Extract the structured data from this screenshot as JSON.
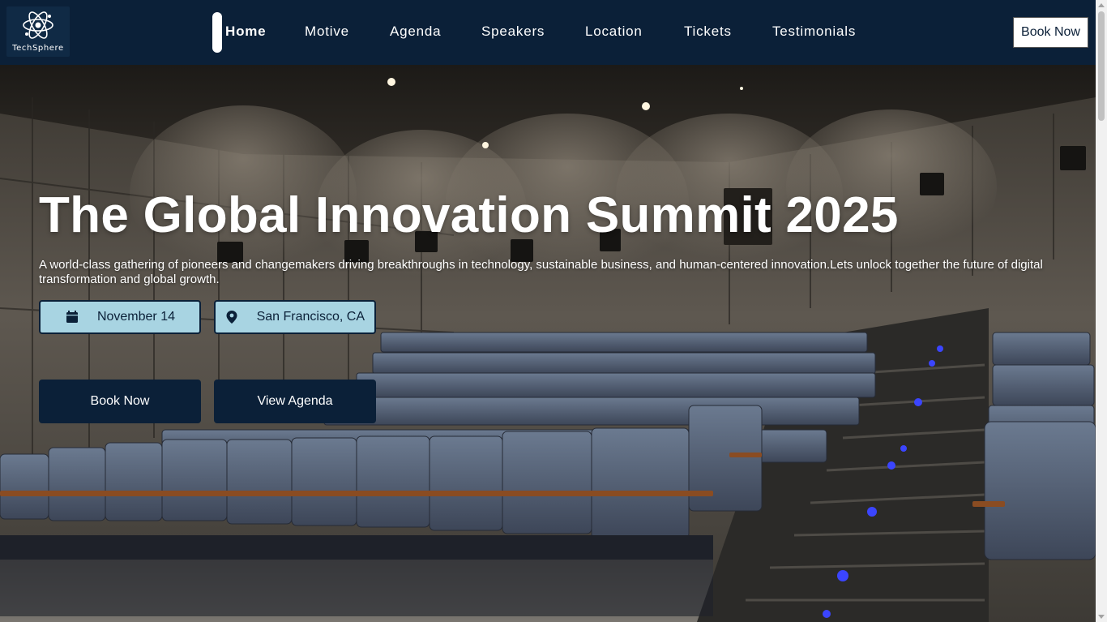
{
  "brand": {
    "name": "TechSphere"
  },
  "nav": {
    "items": [
      {
        "label": "Home"
      },
      {
        "label": "Motive"
      },
      {
        "label": "Agenda"
      },
      {
        "label": "Speakers"
      },
      {
        "label": "Location"
      },
      {
        "label": "Tickets"
      },
      {
        "label": "Testimonials"
      }
    ],
    "active": "Home",
    "book_label": "Book Now"
  },
  "hero": {
    "title": "The Global Innovation Summit 2025",
    "description": "A world-class gathering of pioneers and changemakers driving breakthroughs in technology, sustainable business, and human-centered innovation.Lets unlock together the future of digital transformation and global growth.",
    "date": "November 14",
    "date_icon": "calendar-icon",
    "location": "San Francisco, CA",
    "location_icon": "map-pin-icon",
    "primary_button": "Book Now",
    "secondary_button": "View Agenda"
  },
  "colors": {
    "navy": "#0b2038",
    "pill_bg": "#a8d4e2",
    "white": "#ffffff"
  }
}
